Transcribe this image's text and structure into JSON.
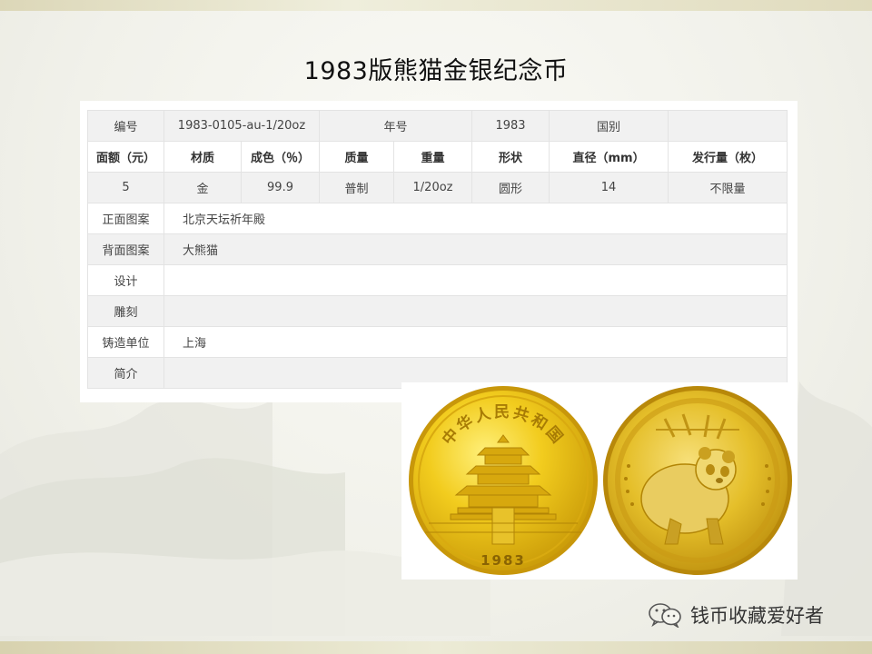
{
  "slide": {
    "title": "1983版熊猫金银纪念币"
  },
  "table": {
    "row1": {
      "label_no": "编号",
      "value_no": "1983-0105-au-1/20oz",
      "label_year": "年号",
      "value_year": "1983",
      "label_country": "国别",
      "value_country": ""
    },
    "headers": [
      "面额（元）",
      "材质",
      "成色（％）",
      "质量",
      "重量",
      "形状",
      "直径（mm）",
      "发行量（枚）"
    ],
    "values": [
      "5",
      "金",
      "99.9",
      "普制",
      "1/20oz",
      "圆形",
      "14",
      "不限量"
    ],
    "details": [
      {
        "label": "正面图案",
        "value": "北京天坛祈年殿"
      },
      {
        "label": "背面图案",
        "value": "大熊猫"
      },
      {
        "label": "设计",
        "value": ""
      },
      {
        "label": "雕刻",
        "value": ""
      },
      {
        "label": "铸造单位",
        "value": "上海"
      },
      {
        "label": "简介",
        "value": ""
      }
    ]
  },
  "coins": {
    "obverse_top_text": "中华人民共和国",
    "obverse_year": "1983",
    "gold_color": "#e3bb14"
  },
  "watermark": {
    "icon": "wechat-icon",
    "text": "钱币收藏爱好者"
  }
}
